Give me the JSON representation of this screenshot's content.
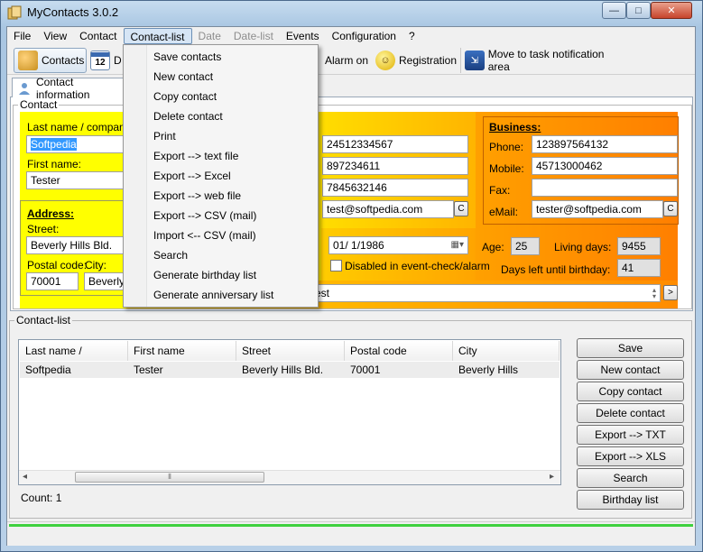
{
  "window": {
    "title": "MyContacts 3.0.2",
    "min": "—",
    "max": "□",
    "close": "✕"
  },
  "menubar": [
    {
      "label": "File",
      "disabled": false
    },
    {
      "label": "View",
      "disabled": false
    },
    {
      "label": "Contact",
      "disabled": false
    },
    {
      "label": "Contact-list",
      "disabled": false,
      "active": true
    },
    {
      "label": "Date",
      "disabled": true
    },
    {
      "label": "Date-list",
      "disabled": true
    },
    {
      "label": "Events",
      "disabled": false
    },
    {
      "label": "Configuration",
      "disabled": false
    },
    {
      "label": "?",
      "disabled": false
    }
  ],
  "toolbar": {
    "contacts": "Contacts",
    "date_partial": "D",
    "calendar_day": "12",
    "alarm": "Alarm on",
    "registration": "Registration",
    "tray": "Move to task notification area"
  },
  "tab": {
    "label": "Contact information"
  },
  "contact": {
    "group_label": "Contact",
    "lastname_label": "Last name / company:",
    "lastname_value": "Softpedia",
    "firstname_label": "First name:",
    "firstname_value": "Tester",
    "address_label": "Address:",
    "street_label": "Street:",
    "street_value": "Beverly Hills Bld.",
    "postal_label": "Postal code:",
    "city_label": "City:",
    "postal_value": "70001",
    "city_value": "Beverly",
    "phone_value": "24512334567",
    "mobile_value": "897234611",
    "fax_value": "7845632146",
    "email_value": "test@softpedia.com",
    "email_btn": "C",
    "birthday_value": "01/ 1/1986",
    "disabled_check": "Disabled in event-check/alarm",
    "age_label": "Age:",
    "age_value": "25",
    "living_label": "Living days:",
    "living_value": "9455",
    "days_left_label": "Days left until birthday:",
    "days_left_value": "41",
    "notes_value": "est",
    "next_btn": ">"
  },
  "business": {
    "label": "Business:",
    "phone_label": "Phone:",
    "phone_value": "123897564132",
    "mobile_label": "Mobile:",
    "mobile_value": "45713000462",
    "fax_label": "Fax:",
    "fax_value": "",
    "email_label": "eMail:",
    "email_value": "tester@softpedia.com",
    "email_btn": "C"
  },
  "list": {
    "group_label": "Contact-list",
    "columns": [
      "Last name / company",
      "First name",
      "Street",
      "Postal code",
      "City"
    ],
    "rows": [
      [
        "Softpedia",
        "Tester",
        "Beverly Hills Bld.",
        "70001",
        "Beverly Hills"
      ]
    ],
    "count": "Count: 1",
    "scroll_left": "◂",
    "scroll_right": "▸",
    "scroll_grip": "⦀"
  },
  "side_buttons": [
    "Save",
    "New contact",
    "Copy contact",
    "Delete contact",
    "Export --> TXT",
    "Export --> XLS",
    "Search",
    "Birthday list"
  ],
  "dropdown": [
    "Save contacts",
    "New contact",
    "Copy contact",
    "Delete contact",
    "Print",
    "Export --> text file",
    "Export --> Excel",
    "Export --> web file",
    "Export --> CSV (mail)",
    "Import <-- CSV (mail)",
    "Search",
    "Generate birthday list",
    "Generate anniversary list"
  ],
  "colors": {
    "yellow": "#ffff00",
    "orange": "#ff8c00",
    "selection": "#3399ff",
    "status_green": "#3fd13f"
  }
}
